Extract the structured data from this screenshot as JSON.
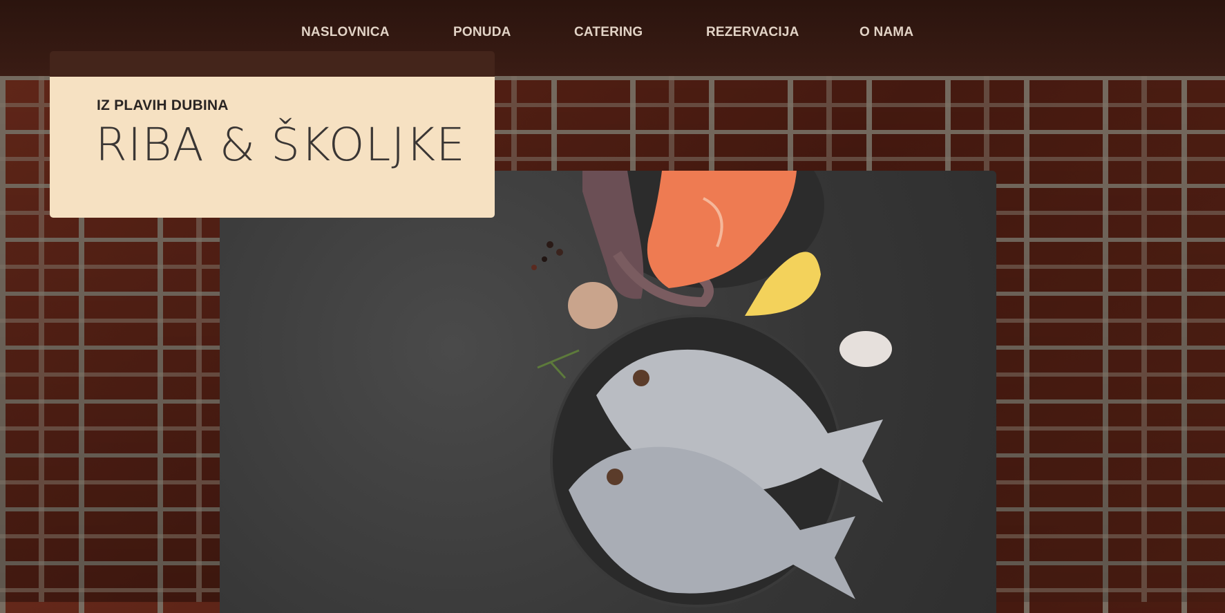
{
  "nav": {
    "items": [
      {
        "label": "NASLOVNICA"
      },
      {
        "label": "PONUDA"
      },
      {
        "label": "CATERING"
      },
      {
        "label": "REZERVACIJA"
      },
      {
        "label": "O NAMA"
      }
    ]
  },
  "card": {
    "kicker": "IZ PLAVIH DUBINA",
    "headline": "RIBA & ŠKOLJKE"
  },
  "colors": {
    "nav_bar": "#2f1610",
    "card_background": "#f6e1c2",
    "card_header": "#44251b",
    "nav_text": "#e2d3c6",
    "hero_background": "#3e3e3e"
  }
}
